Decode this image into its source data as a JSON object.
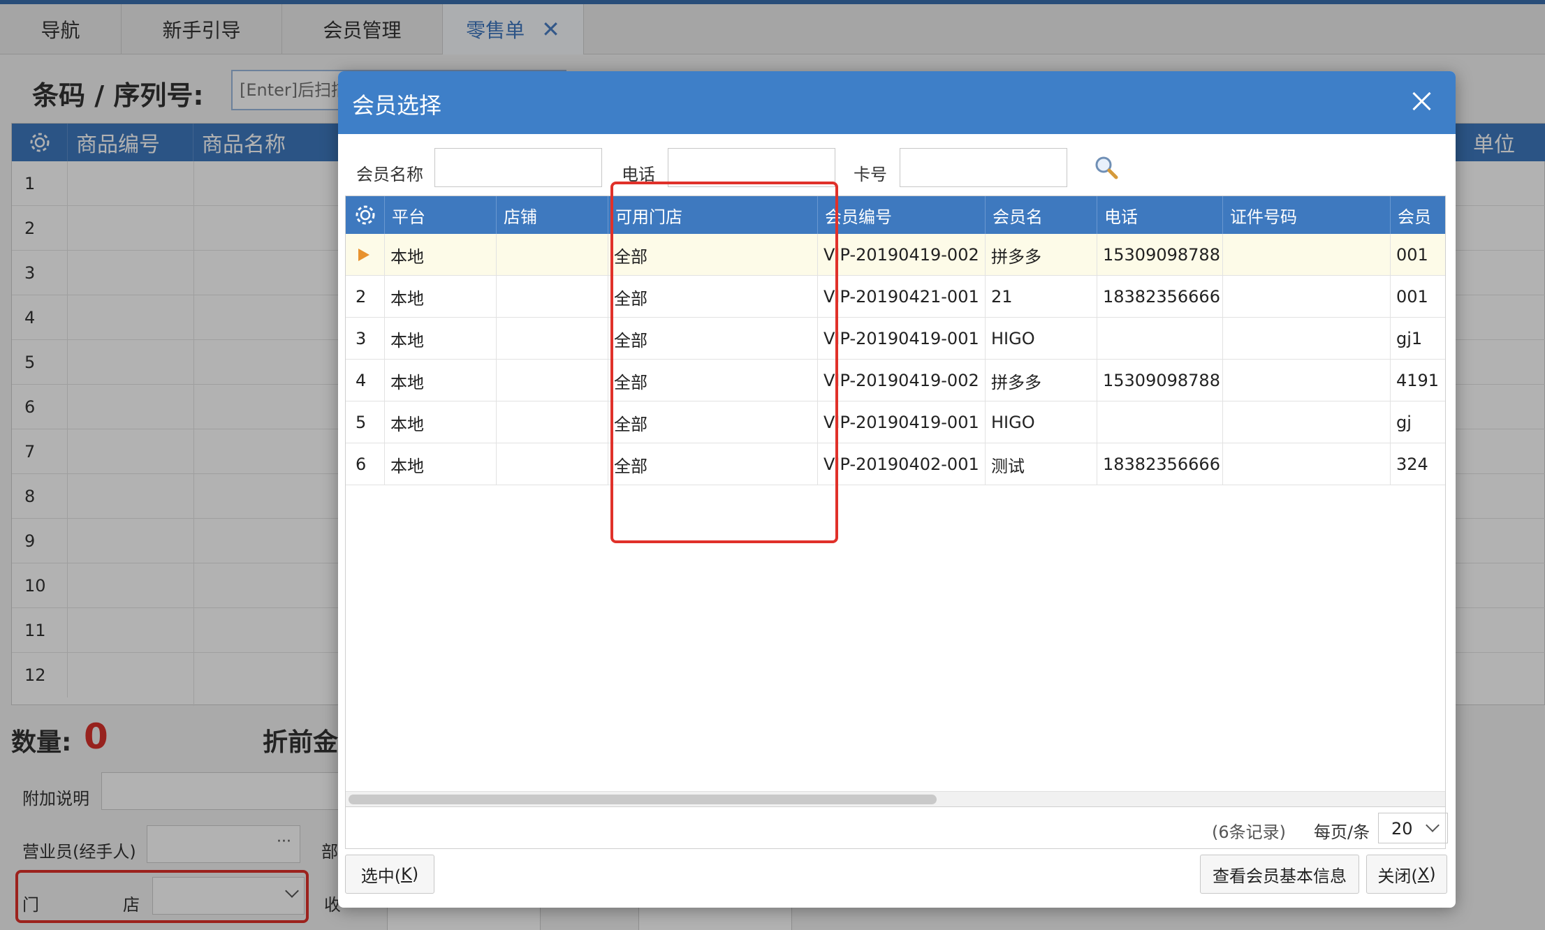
{
  "app": {
    "tabs": [
      {
        "label": "导航"
      },
      {
        "label": "新手引导"
      },
      {
        "label": "会员管理"
      },
      {
        "label": "零售单"
      }
    ],
    "barcode": {
      "label": "条码 / 序列号:",
      "placeholder": "[Enter]后扫描"
    },
    "grid": {
      "headers": [
        "商品编号",
        "商品名称",
        "单位"
      ],
      "row_numbers": [
        "1",
        "2",
        "3",
        "4",
        "5",
        "6",
        "7",
        "8",
        "9",
        "10",
        "11",
        "12"
      ]
    },
    "summary": {
      "qty_label": "数量:",
      "qty_value": "0",
      "discount_label": "折前金"
    },
    "form": {
      "remark_label": "附加说明",
      "salesman_label": "营业员(经手人)",
      "salesman_dots": "···",
      "dept_label": "部",
      "store_label_a": "门",
      "store_label_b": "店",
      "receive_label": "收"
    }
  },
  "dialog": {
    "title": "会员选择",
    "search": {
      "name_label": "会员名称",
      "phone_label": "电话",
      "card_label": "卡号"
    },
    "columns": [
      "平台",
      "店铺",
      "可用门店",
      "会员编号",
      "会员名",
      "电话",
      "证件号码",
      "会员"
    ],
    "rows": [
      {
        "no": "",
        "platform": "本地",
        "shop": "",
        "stores": "全部",
        "code": "VIP-20190419-002",
        "name": "拼多多",
        "phone": "15309098788",
        "idno": "",
        "card": "001"
      },
      {
        "no": "2",
        "platform": "本地",
        "shop": "",
        "stores": "全部",
        "code": "VIP-20190421-001",
        "name": "21",
        "phone": "18382356666",
        "idno": "",
        "card": "001"
      },
      {
        "no": "3",
        "platform": "本地",
        "shop": "",
        "stores": "全部",
        "code": "VIP-20190419-001",
        "name": "HIGO",
        "phone": "",
        "idno": "",
        "card": "gj1"
      },
      {
        "no": "4",
        "platform": "本地",
        "shop": "",
        "stores": "全部",
        "code": "VIP-20190419-002",
        "name": "拼多多",
        "phone": "15309098788",
        "idno": "",
        "card": "4191"
      },
      {
        "no": "5",
        "platform": "本地",
        "shop": "",
        "stores": "全部",
        "code": "VIP-20190419-001",
        "name": "HIGO",
        "phone": "",
        "idno": "",
        "card": "gj"
      },
      {
        "no": "6",
        "platform": "本地",
        "shop": "",
        "stores": "全部",
        "code": "VIP-20190402-001",
        "name": "测试",
        "phone": "18382356666",
        "idno": "",
        "card": "324"
      }
    ],
    "pager": {
      "count": "(6条记录)",
      "per_page_label": "每页/条",
      "per_page": "20"
    },
    "buttons": {
      "select": "选中(",
      "select_key": "K",
      "view_info": "查看会员基本信息",
      "close": "关闭(",
      "close_key": "X",
      "paren": ")"
    }
  },
  "colors": {
    "header_blue": "#3e79bf",
    "highlight_red": "#e0312a",
    "selected_row": "#fdfbe8",
    "row_arrow": "#e8922e"
  }
}
